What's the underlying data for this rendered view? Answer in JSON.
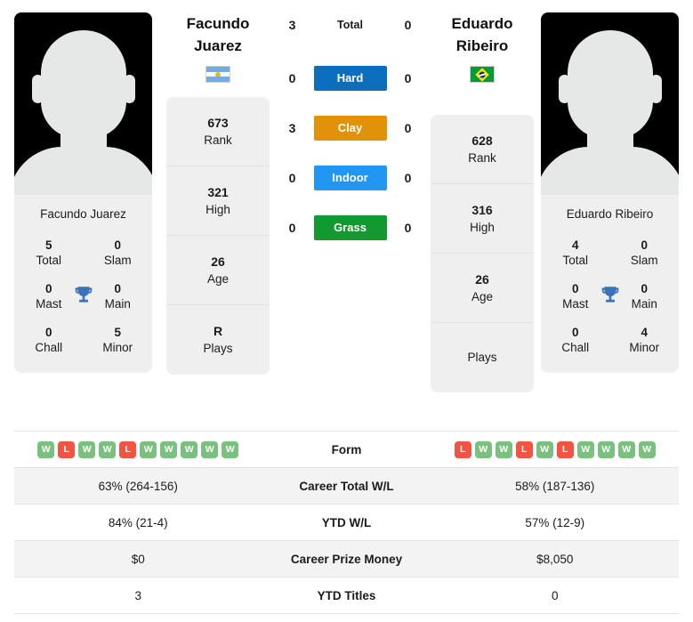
{
  "players": {
    "left": {
      "first_name": "Facundo",
      "last_name": "Juarez",
      "full_name": "Facundo Juarez",
      "flag": "argentina-flag-icon",
      "rank": "673",
      "rank_label": "Rank",
      "high": "321",
      "high_label": "High",
      "age": "26",
      "age_label": "Age",
      "plays": "R",
      "plays_label": "Plays",
      "titles": {
        "total": "5",
        "total_label": "Total",
        "slam": "0",
        "slam_label": "Slam",
        "mast": "0",
        "mast_label": "Mast",
        "main": "0",
        "main_label": "Main",
        "chall": "0",
        "chall_label": "Chall",
        "minor": "5",
        "minor_label": "Minor"
      },
      "form": [
        "W",
        "L",
        "W",
        "W",
        "L",
        "W",
        "W",
        "W",
        "W",
        "W"
      ],
      "career_wl": "63% (264-156)",
      "ytd_wl": "84% (21-4)",
      "career_prize": "$0",
      "ytd_titles": "3"
    },
    "right": {
      "first_name": "Eduardo",
      "last_name": "Ribeiro",
      "full_name": "Eduardo Ribeiro",
      "flag": "brazil-flag-icon",
      "rank": "628",
      "rank_label": "Rank",
      "high": "316",
      "high_label": "High",
      "age": "26",
      "age_label": "Age",
      "plays": "",
      "plays_label": "Plays",
      "titles": {
        "total": "4",
        "total_label": "Total",
        "slam": "0",
        "slam_label": "Slam",
        "mast": "0",
        "mast_label": "Mast",
        "main": "0",
        "main_label": "Main",
        "chall": "0",
        "chall_label": "Chall",
        "minor": "4",
        "minor_label": "Minor"
      },
      "form": [
        "L",
        "W",
        "W",
        "L",
        "W",
        "L",
        "W",
        "W",
        "W",
        "W"
      ],
      "career_wl": "58% (187-136)",
      "ytd_wl": "57% (12-9)",
      "career_prize": "$8,050",
      "ytd_titles": "0"
    }
  },
  "head_to_head": [
    {
      "label": "Total",
      "left": "3",
      "right": "0",
      "style": "plain",
      "color": ""
    },
    {
      "label": "Hard",
      "left": "0",
      "right": "0",
      "style": "chip",
      "color": "#0d6ebd"
    },
    {
      "label": "Clay",
      "left": "3",
      "right": "0",
      "style": "chip",
      "color": "#e29208"
    },
    {
      "label": "Indoor",
      "left": "0",
      "right": "0",
      "style": "chip",
      "color": "#2196f3"
    },
    {
      "label": "Grass",
      "left": "0",
      "right": "0",
      "style": "chip",
      "color": "#12992f"
    }
  ],
  "stats_rows": [
    {
      "key": "form",
      "label": "Form",
      "type": "form"
    },
    {
      "key": "career_wl",
      "label": "Career Total W/L",
      "type": "text"
    },
    {
      "key": "ytd_wl",
      "label": "YTD W/L",
      "type": "text"
    },
    {
      "key": "career_prize",
      "label": "Career Prize Money",
      "type": "text"
    },
    {
      "key": "ytd_titles",
      "label": "YTD Titles",
      "type": "text"
    }
  ],
  "colors": {
    "win_badge": "#7ac17f",
    "loss_badge": "#f05542",
    "card_bg": "#efefef",
    "row_alt_bg": "#f3f3f3",
    "trophy": "#3c72b8"
  },
  "icons": {
    "trophy": "trophy-icon"
  }
}
